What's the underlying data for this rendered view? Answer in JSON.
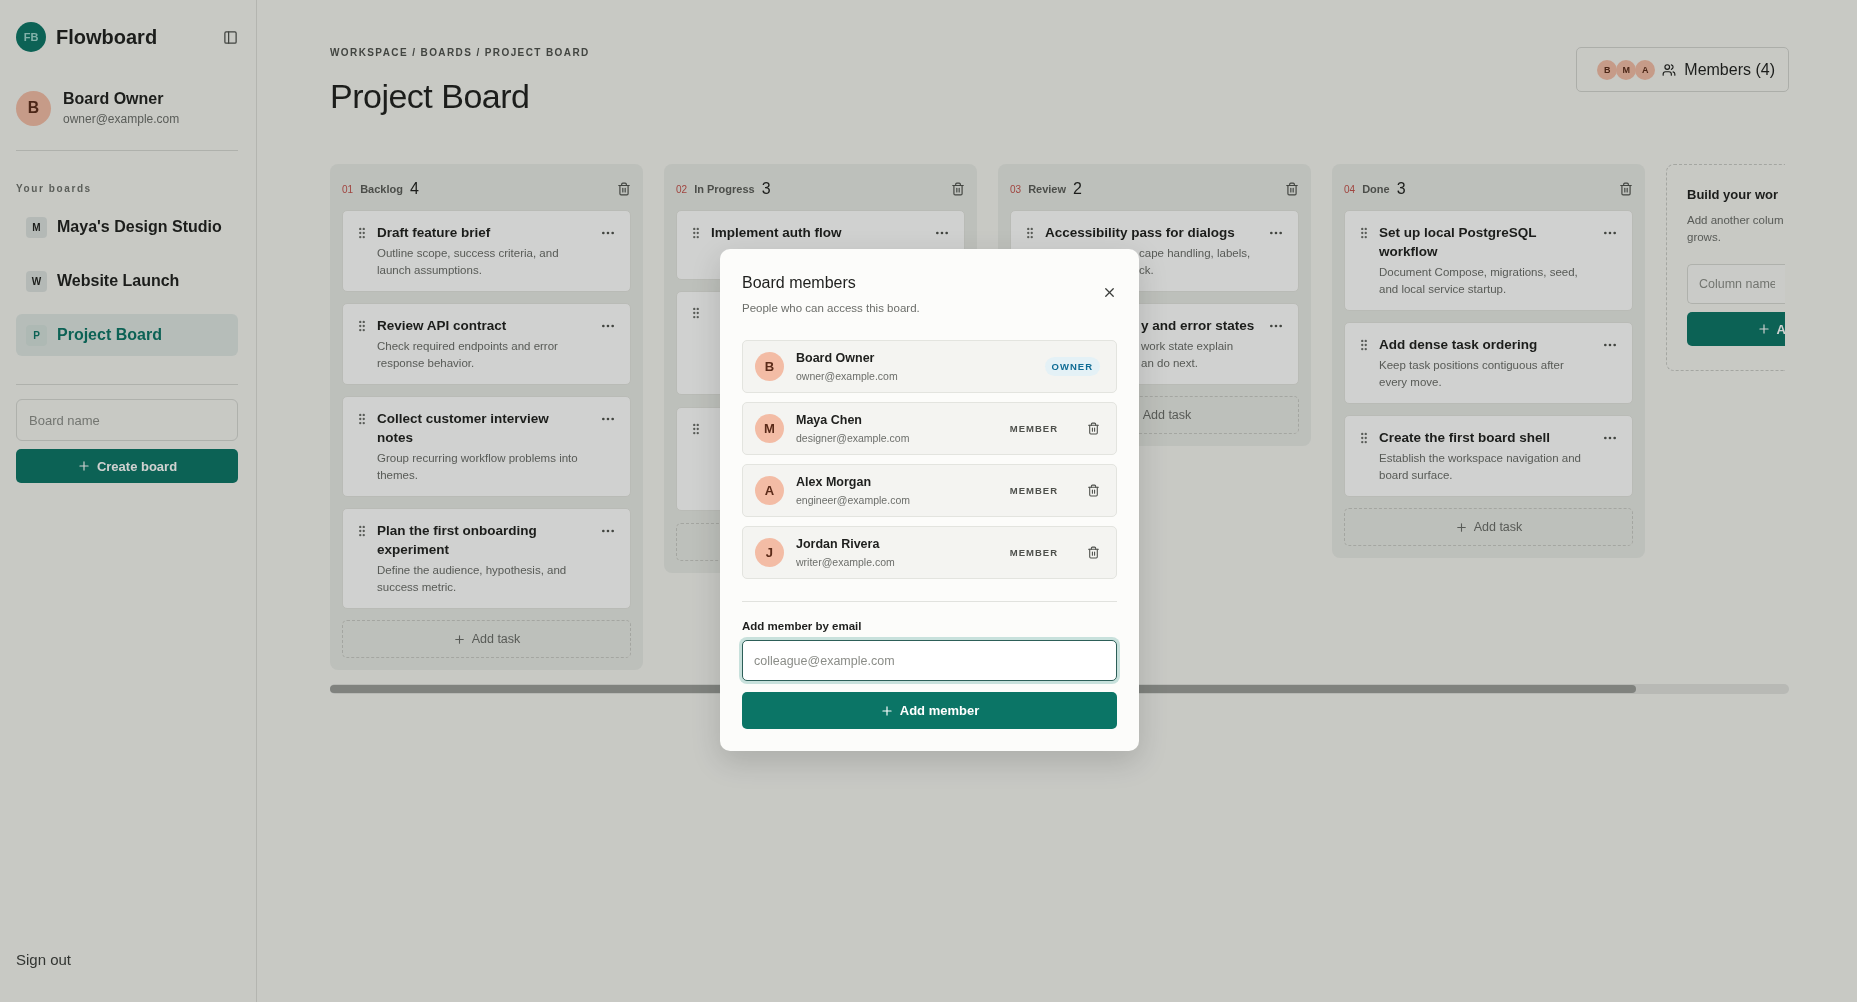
{
  "sidebar": {
    "logo": "FB",
    "app_name": "Flowboard",
    "user": {
      "initial": "B",
      "name": "Board Owner",
      "email": "owner@example.com"
    },
    "boards_label": "Your boards",
    "boards": [
      {
        "initial": "M",
        "name": "Maya's Design Studio",
        "selected": false
      },
      {
        "initial": "W",
        "name": "Website Launch",
        "selected": false
      },
      {
        "initial": "P",
        "name": "Project Board",
        "selected": true
      }
    ],
    "new_board": {
      "placeholder": "Board name"
    },
    "create_button": "Create board",
    "sign_out": "Sign out"
  },
  "header": {
    "breadcrumb": "WORKSPACE / BOARDS / PROJECT BOARD",
    "title": "Project Board",
    "member_initials": [
      "B",
      "M",
      "A"
    ],
    "members_button": "Members (4)"
  },
  "columns": [
    {
      "number": "01",
      "name": "Backlog",
      "count": "4",
      "add_task": "Add task",
      "add_task_icon": true,
      "tasks": [
        {
          "kind": "full",
          "title": "Draft feature brief",
          "description": "Outline scope, success criteria, and launch assumptions."
        },
        {
          "kind": "full",
          "title": "Review API contract",
          "description": "Check required endpoints and error response behavior."
        },
        {
          "kind": "full",
          "title": "Collect customer interview notes",
          "description": "Group recurring workflow problems into themes."
        },
        {
          "kind": "full",
          "title": "Plan the first onboarding experiment",
          "description": "Define the audience, hypothesis, and success metric."
        }
      ]
    },
    {
      "number": "02",
      "name": "In Progress",
      "count": "3",
      "tasks": [
        {
          "kind": "full",
          "title": "Implement auth flow"
        },
        {
          "kind": "covered"
        },
        {
          "kind": "covered"
        }
      ]
    },
    {
      "number": "03",
      "name": "Review",
      "count": "2",
      "add_task": "Add task",
      "add_task_icon": false,
      "tasks": [
        {
          "kind": "covered-description",
          "title": "Accessibility pass for dialogs",
          "description": "cape handling, labels,\nck."
        },
        {
          "kind": "partly-covered",
          "title": "y and error states",
          "description": "work state explain\nan do next."
        }
      ]
    },
    {
      "number": "04",
      "name": "Done",
      "count": "3",
      "add_task": "Add task",
      "add_task_icon": true,
      "tasks": [
        {
          "kind": "full",
          "title": "Set up local PostgreSQL workflow",
          "description": "Document Compose, migrations, seed, and local service startup."
        },
        {
          "kind": "full",
          "title": "Add dense task ordering",
          "description": "Keep task positions contiguous after every move."
        },
        {
          "kind": "full",
          "title": "Create the first board shell",
          "description": "Establish the workspace navigation and board surface."
        }
      ]
    }
  ],
  "add_column": {
    "title": "Build your wor",
    "description": "Add another colum\ngrows.",
    "placeholder": "Column name",
    "button": "A"
  },
  "dialog": {
    "title": "Board members",
    "subtitle": "People who can access this board.",
    "members": [
      {
        "kind": "owner",
        "initial": "B",
        "name": "Board Owner",
        "email": "owner@example.com",
        "role": "OWNER"
      },
      {
        "kind": "member",
        "initial": "M",
        "name": "Maya Chen",
        "email": "designer@example.com",
        "role": "MEMBER"
      },
      {
        "kind": "member",
        "initial": "A",
        "name": "Alex Morgan",
        "email": "engineer@example.com",
        "role": "MEMBER"
      },
      {
        "kind": "member",
        "initial": "J",
        "name": "Jordan Rivera",
        "email": "writer@example.com",
        "role": "MEMBER"
      }
    ],
    "add_label": "Add member by email",
    "email": {
      "placeholder": "colleague@example.com",
      "focused": true
    },
    "add_button": "Add member"
  }
}
